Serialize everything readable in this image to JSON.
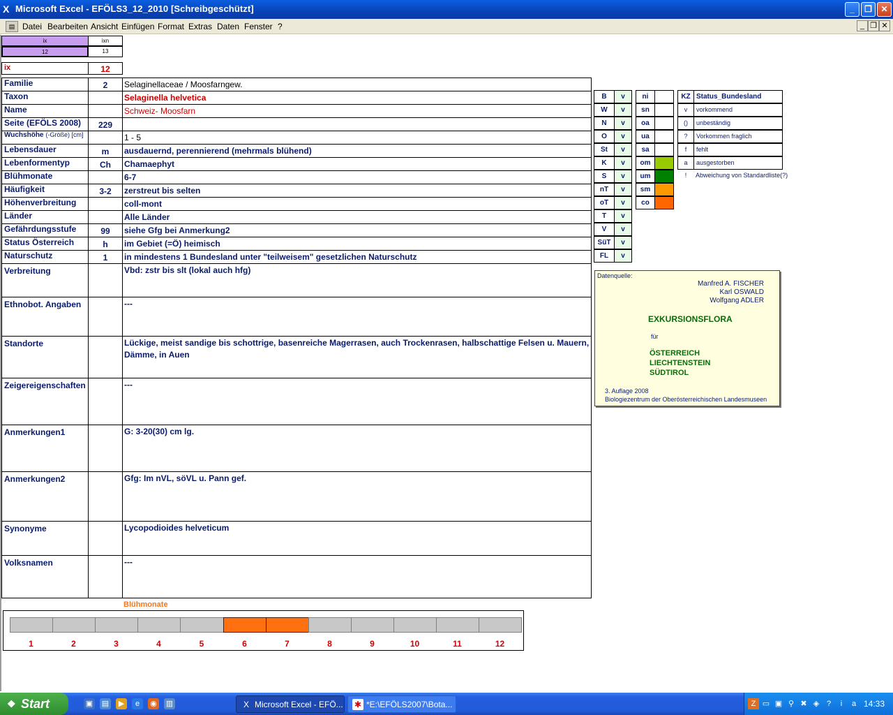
{
  "window": {
    "title": "Microsoft Excel - EFÖLS3_12_2010  [Schreibgeschützt]"
  },
  "menu": [
    "Datei",
    "Bearbeiten",
    "Ansicht",
    "Einfügen",
    "Format",
    "Extras",
    "Daten",
    "Fenster",
    "?"
  ],
  "index": {
    "h1": "ix",
    "h2": "ixn",
    "v1": "12",
    "v2": "13",
    "ix_label": "ix",
    "ix_value": "12"
  },
  "rows": [
    {
      "label": "Familie",
      "num": "2",
      "value": "Selaginellaceae  /  Moosfarngew."
    },
    {
      "label": "Taxon",
      "num": "",
      "value": "Selaginella helvetica"
    },
    {
      "label": "Name",
      "num": "",
      "value": "Schweiz- Moosfarn"
    },
    {
      "label": "Seite (EFÖLS 2008)",
      "num": "229",
      "value": ""
    },
    {
      "label": "Wuchshöhe",
      "label_small": "(-Größe) [cm]",
      "num": "",
      "value": " 1 - 5"
    },
    {
      "label": "Lebensdauer",
      "num": "m",
      "value": "ausdauernd, perennierend (mehrmals blühend)"
    },
    {
      "label": "Lebenformentyp",
      "num": "Ch",
      "value": "Chamaephyt"
    },
    {
      "label": "Blühmonate",
      "num": "",
      "value": " 6-7"
    },
    {
      "label": "Häufigkeit",
      "num": "3-2",
      "value": "zerstreut bis selten"
    },
    {
      "label": "Höhenverbreitung",
      "num": "",
      "value": "coll-mont"
    },
    {
      "label": "Länder",
      "num": "",
      "value": "Alle Länder"
    },
    {
      "label": "Gefährdungsstufe",
      "num": "99",
      "value": "siehe Gfg bei Anmerkung2"
    },
    {
      "label": "Status Österreich",
      "num": "h",
      "value": "im Gebiet (=Ö) heimisch"
    },
    {
      "label": "Naturschutz",
      "num": "1",
      "value": "in mindestens 1 Bundesland unter \"teilweisem\" gesetzlichen Naturschutz"
    }
  ],
  "bigrows": [
    {
      "label": "Verbreitung",
      "value": "Vbd: zstr bis slt (lokal auch hfg)"
    },
    {
      "label": "Ethnobot. Angaben",
      "value": "---"
    },
    {
      "label": "Standorte",
      "value": "Lückige, meist sandige bis schottrige, basenreiche Magerrasen, auch Trockenrasen, halbschattige Felsen u. Mauern, Dämme, in Auen"
    },
    {
      "label": "Zeigereigenschaften",
      "value": "---"
    },
    {
      "label": "Anmerkungen1",
      "value": "G: 3-20(30) cm lg."
    },
    {
      "label": "Anmerkungen2",
      "value": "Gfg: Im nVL, söVL u. Pann gef."
    },
    {
      "label": "Synonyme",
      "value": "Lycopodioides helveticum"
    },
    {
      "label": "Volksnamen",
      "value": "---"
    }
  ],
  "codes1": [
    {
      "k": "B",
      "v": "v"
    },
    {
      "k": "W",
      "v": "v"
    },
    {
      "k": "N",
      "v": "v"
    },
    {
      "k": "O",
      "v": "v"
    },
    {
      "k": "St",
      "v": "v"
    },
    {
      "k": "K",
      "v": "v"
    },
    {
      "k": "S",
      "v": "v"
    },
    {
      "k": "nT",
      "v": "v"
    },
    {
      "k": "oT",
      "v": "v"
    },
    {
      "k": "T",
      "v": "v"
    },
    {
      "k": "V",
      "v": "v"
    },
    {
      "k": "SüT",
      "v": "v"
    },
    {
      "k": "FL",
      "v": "v"
    }
  ],
  "codes2": [
    {
      "k": "ni",
      "color": ""
    },
    {
      "k": "sn",
      "color": ""
    },
    {
      "k": "oa",
      "color": ""
    },
    {
      "k": "ua",
      "color": ""
    },
    {
      "k": "sa",
      "color": ""
    },
    {
      "k": "om",
      "color": "#99cc00"
    },
    {
      "k": "um",
      "color": "#008000"
    },
    {
      "k": "sm",
      "color": "#ff9900"
    },
    {
      "k": "co",
      "color": "#ff6600"
    }
  ],
  "legend": {
    "header_kz": "KZ",
    "header_status": "Status_Bundesland",
    "items": [
      {
        "kz": "v",
        "text": "vorkommend"
      },
      {
        "kz": "()",
        "text": "unbeständig"
      },
      {
        "kz": "?",
        "text": "Vorkommen fraglich"
      },
      {
        "kz": "f",
        "text": "fehlt"
      },
      {
        "kz": "a",
        "text": "ausgestorben"
      },
      {
        "kz": "!",
        "text": "Abweichung von Standardliste(?)"
      }
    ]
  },
  "source": {
    "label": "Datenquelle:",
    "authors": [
      "Manfred A. FISCHER",
      "Karl OSWALD",
      "Wolfgang ADLER"
    ],
    "title": "EXKURSIONSFLORA",
    "fuer": "für",
    "countries": [
      "ÖSTERREICH",
      "LIECHTENSTEIN",
      "SÜDTIROL"
    ],
    "edition": "3. Auflage 2008",
    "publisher": "Biologiezentrum der Oberösterreichischen Landesmuseen"
  },
  "months": {
    "title": "Blühmonate",
    "labels": [
      "1",
      "2",
      "3",
      "4",
      "5",
      "6",
      "7",
      "8",
      "9",
      "10",
      "11",
      "12"
    ],
    "active": [
      6,
      7
    ]
  },
  "taskbar": {
    "start": "Start",
    "tasks": [
      "Microsoft Excel - EFÖ...",
      "*E:\\EFÖLS2007\\Bota..."
    ],
    "clock": "14:33"
  },
  "colors": {
    "accent_blue": "#0a1c6e",
    "red": "#d20000",
    "bar_on": "#ff7010",
    "bar_off": "#c8c8c8",
    "code_green": "#e7fbe7"
  }
}
